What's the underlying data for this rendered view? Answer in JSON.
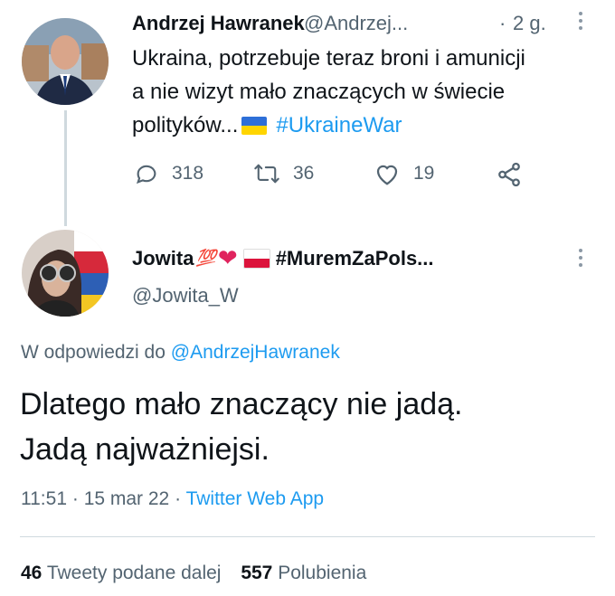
{
  "parent_tweet": {
    "author_name": "Andrzej Hawranek",
    "author_handle": "@Andrzej...",
    "time_sep": "·",
    "time": "2 g.",
    "text_line1": "Ukraina, potrzebuje teraz broni i amunicji",
    "text_line2": "a nie wizyt mało znaczących w świecie",
    "text_line3_prefix": "polityków...",
    "hashtag": "#UkraineWar",
    "replies": "318",
    "retweets": "36",
    "likes": "19"
  },
  "reply_tweet": {
    "author_name": "Jowita",
    "author_emoji_100": "💯",
    "author_heart": "❤",
    "author_suffix": "#MuremZaPols...",
    "author_handle": "@Jowita_W",
    "reply_prefix": "W odpowiedzi do",
    "reply_to": "@AndrzejHawranek",
    "text_line1": "Dlatego mało znaczący nie jadą.",
    "text_line2": "Jadą najważniejsi.",
    "time": "11:51",
    "sep1": "·",
    "date": "15 mar 22",
    "sep2": "·",
    "source": "Twitter Web App",
    "retweet_count": "46",
    "retweet_label": "Tweety podane dalej",
    "like_count": "557",
    "like_label": "Polubienia"
  },
  "colors": {
    "accent": "#1d9bf0",
    "muted": "#536471",
    "text": "#0f1419",
    "divider": "#cfd9de"
  },
  "icons": {
    "reply": "comment-icon",
    "retweet": "retweet-icon",
    "like": "heart-icon",
    "share": "share-icon",
    "more": "more-dots-icon"
  }
}
